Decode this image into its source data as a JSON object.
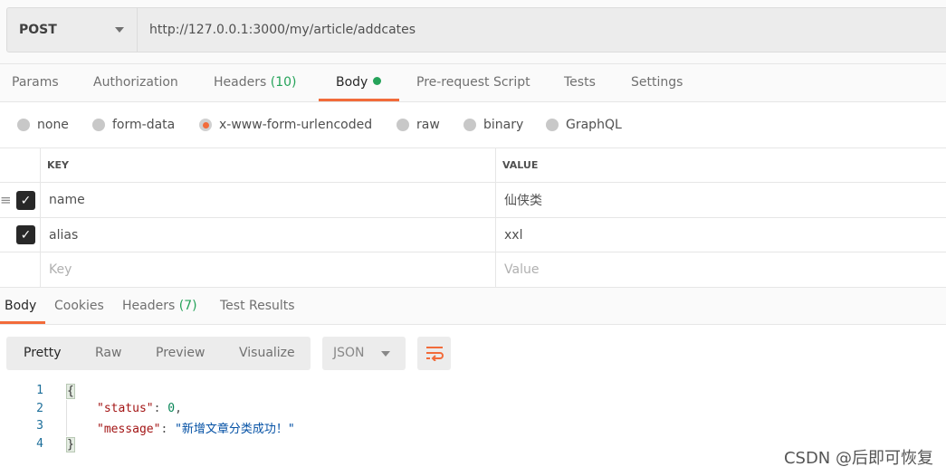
{
  "request": {
    "method": "POST",
    "url": "http://127.0.0.1:3000/my/article/addcates"
  },
  "tabs": [
    {
      "label": "Params"
    },
    {
      "label": "Authorization"
    },
    {
      "label": "Headers",
      "count": "(10)"
    },
    {
      "label": "Body",
      "active": true
    },
    {
      "label": "Pre-request Script"
    },
    {
      "label": "Tests"
    },
    {
      "label": "Settings"
    }
  ],
  "body_modes": [
    {
      "label": "none"
    },
    {
      "label": "form-data"
    },
    {
      "label": "x-www-form-urlencoded",
      "selected": true
    },
    {
      "label": "raw"
    },
    {
      "label": "binary"
    },
    {
      "label": "GraphQL"
    }
  ],
  "table": {
    "headers": {
      "key": "KEY",
      "value": "VALUE"
    },
    "rows": [
      {
        "key": "name",
        "value": "仙侠类",
        "checked": true
      },
      {
        "key": "alias",
        "value": "xxl",
        "checked": true
      }
    ],
    "placeholders": {
      "key": "Key",
      "value": "Value"
    }
  },
  "response_tabs": [
    {
      "label": "Body",
      "active": true
    },
    {
      "label": "Cookies"
    },
    {
      "label": "Headers",
      "count": "(7)"
    },
    {
      "label": "Test Results"
    }
  ],
  "view_modes": [
    "Pretty",
    "Raw",
    "Preview",
    "Visualize"
  ],
  "format": "JSON",
  "code": {
    "lines": [
      "1",
      "2",
      "3",
      "4"
    ],
    "open": "{",
    "close": "}",
    "k1": "\"status\"",
    "v1": "0",
    "k2": "\"message\"",
    "v2": "\"新增文章分类成功！\""
  },
  "watermark": "CSDN @后即可恢复",
  "colors": {
    "accent": "#f26b3a",
    "success": "#26a35a"
  }
}
